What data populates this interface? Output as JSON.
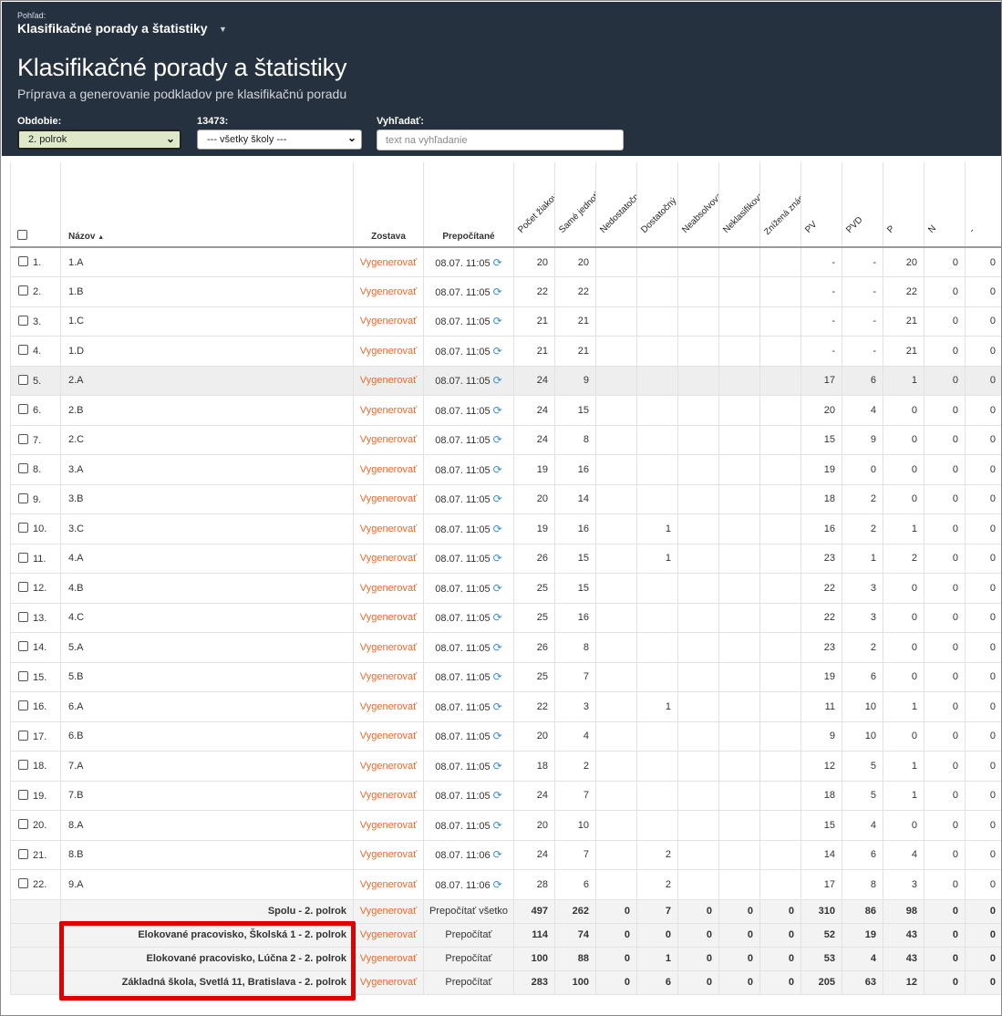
{
  "header": {
    "view_label": "Pohľad:",
    "view_title": "Klasifikačné porady a štatistiky",
    "title": "Klasifikačné porady a štatistiky",
    "subtitle": "Príprava a generovanie podkladov pre klasifikačnú poradu"
  },
  "filters": {
    "period_label": "Obdobie:",
    "period_value": "2. polrok",
    "school_label": "13473:",
    "school_value": "--- všetky školy ---",
    "search_label": "Vyhľadať:",
    "search_placeholder": "text na vyhľadanie"
  },
  "table": {
    "columns": {
      "name": "Názov",
      "sort_indicator": "▲",
      "report": "Zostava",
      "recalc": "Prepočítané",
      "stats": [
        "Počet žiakov",
        "Samé jednotky",
        "Nedostatočný",
        "Dostatočný",
        "Neabsolvoval(a)",
        "Neklasifikovaný(á)",
        "Znížená známka zo správania",
        "PV",
        "PVD",
        "P",
        "N",
        "-"
      ]
    },
    "generate_label": "Vygenerovať",
    "refresh_icon": "refresh-icon",
    "rows": [
      {
        "num": "1.",
        "name": "1.A",
        "date": "08.07. 11:05",
        "v": [
          "20",
          "20",
          "",
          "",
          "",
          "",
          "",
          "-",
          "-",
          "20",
          "0",
          "0"
        ]
      },
      {
        "num": "2.",
        "name": "1.B",
        "date": "08.07. 11:05",
        "v": [
          "22",
          "22",
          "",
          "",
          "",
          "",
          "",
          "-",
          "-",
          "22",
          "0",
          "0"
        ]
      },
      {
        "num": "3.",
        "name": "1.C",
        "date": "08.07. 11:05",
        "v": [
          "21",
          "21",
          "",
          "",
          "",
          "",
          "",
          "-",
          "-",
          "21",
          "0",
          "0"
        ]
      },
      {
        "num": "4.",
        "name": "1.D",
        "date": "08.07. 11:05",
        "v": [
          "21",
          "21",
          "",
          "",
          "",
          "",
          "",
          "-",
          "-",
          "21",
          "0",
          "0"
        ]
      },
      {
        "num": "5.",
        "name": "2.A",
        "date": "08.07. 11:05",
        "v": [
          "24",
          "9",
          "",
          "",
          "",
          "",
          "",
          "17",
          "6",
          "1",
          "0",
          "0"
        ],
        "highlight": true
      },
      {
        "num": "6.",
        "name": "2.B",
        "date": "08.07. 11:05",
        "v": [
          "24",
          "15",
          "",
          "",
          "",
          "",
          "",
          "20",
          "4",
          "0",
          "0",
          "0"
        ]
      },
      {
        "num": "7.",
        "name": "2.C",
        "date": "08.07. 11:05",
        "v": [
          "24",
          "8",
          "",
          "",
          "",
          "",
          "",
          "15",
          "9",
          "0",
          "0",
          "0"
        ]
      },
      {
        "num": "8.",
        "name": "3.A",
        "date": "08.07. 11:05",
        "v": [
          "19",
          "16",
          "",
          "",
          "",
          "",
          "",
          "19",
          "0",
          "0",
          "0",
          "0"
        ]
      },
      {
        "num": "9.",
        "name": "3.B",
        "date": "08.07. 11:05",
        "v": [
          "20",
          "14",
          "",
          "",
          "",
          "",
          "",
          "18",
          "2",
          "0",
          "0",
          "0"
        ]
      },
      {
        "num": "10.",
        "name": "3.C",
        "date": "08.07. 11:05",
        "v": [
          "19",
          "16",
          "",
          "1",
          "",
          "",
          "",
          "16",
          "2",
          "1",
          "0",
          "0"
        ]
      },
      {
        "num": "11.",
        "name": "4.A",
        "date": "08.07. 11:05",
        "v": [
          "26",
          "15",
          "",
          "1",
          "",
          "",
          "",
          "23",
          "1",
          "2",
          "0",
          "0"
        ]
      },
      {
        "num": "12.",
        "name": "4.B",
        "date": "08.07. 11:05",
        "v": [
          "25",
          "15",
          "",
          "",
          "",
          "",
          "",
          "22",
          "3",
          "0",
          "0",
          "0"
        ]
      },
      {
        "num": "13.",
        "name": "4.C",
        "date": "08.07. 11:05",
        "v": [
          "25",
          "16",
          "",
          "",
          "",
          "",
          "",
          "22",
          "3",
          "0",
          "0",
          "0"
        ]
      },
      {
        "num": "14.",
        "name": "5.A",
        "date": "08.07. 11:05",
        "v": [
          "26",
          "8",
          "",
          "",
          "",
          "",
          "",
          "23",
          "2",
          "0",
          "0",
          "0"
        ]
      },
      {
        "num": "15.",
        "name": "5.B",
        "date": "08.07. 11:05",
        "v": [
          "25",
          "7",
          "",
          "",
          "",
          "",
          "",
          "19",
          "6",
          "0",
          "0",
          "0"
        ]
      },
      {
        "num": "16.",
        "name": "6.A",
        "date": "08.07. 11:05",
        "v": [
          "22",
          "3",
          "",
          "1",
          "",
          "",
          "",
          "11",
          "10",
          "1",
          "0",
          "0"
        ]
      },
      {
        "num": "17.",
        "name": "6.B",
        "date": "08.07. 11:05",
        "v": [
          "20",
          "4",
          "",
          "",
          "",
          "",
          "",
          "9",
          "10",
          "0",
          "0",
          "0"
        ]
      },
      {
        "num": "18.",
        "name": "7.A",
        "date": "08.07. 11:05",
        "v": [
          "18",
          "2",
          "",
          "",
          "",
          "",
          "",
          "12",
          "5",
          "1",
          "0",
          "0"
        ]
      },
      {
        "num": "19.",
        "name": "7.B",
        "date": "08.07. 11:05",
        "v": [
          "24",
          "7",
          "",
          "",
          "",
          "",
          "",
          "18",
          "5",
          "1",
          "0",
          "0"
        ]
      },
      {
        "num": "20.",
        "name": "8.A",
        "date": "08.07. 11:05",
        "v": [
          "20",
          "10",
          "",
          "",
          "",
          "",
          "",
          "15",
          "4",
          "0",
          "0",
          "0"
        ]
      },
      {
        "num": "21.",
        "name": "8.B",
        "date": "08.07. 11:06",
        "v": [
          "24",
          "7",
          "",
          "2",
          "",
          "",
          "",
          "14",
          "6",
          "4",
          "0",
          "0"
        ]
      },
      {
        "num": "22.",
        "name": "9.A",
        "date": "08.07. 11:06",
        "v": [
          "28",
          "6",
          "",
          "2",
          "",
          "",
          "",
          "17",
          "8",
          "3",
          "0",
          "0"
        ]
      }
    ],
    "summaries": [
      {
        "name": "Spolu - 2. polrok",
        "recalc": "Prepočítať všetko",
        "v": [
          "497",
          "262",
          "0",
          "7",
          "0",
          "0",
          "0",
          "310",
          "86",
          "98",
          "0",
          "0"
        ]
      },
      {
        "name": "Elokované pracovisko, Školská 1  - 2. polrok",
        "recalc": "Prepočítať",
        "v": [
          "114",
          "74",
          "0",
          "0",
          "0",
          "0",
          "0",
          "52",
          "19",
          "43",
          "0",
          "0"
        ]
      },
      {
        "name": "Elokované pracovisko, Lúčna 2  - 2. polrok",
        "recalc": "Prepočítať",
        "v": [
          "100",
          "88",
          "0",
          "1",
          "0",
          "0",
          "0",
          "53",
          "4",
          "43",
          "0",
          "0"
        ]
      },
      {
        "name": "Základná škola, Svetlá 11, Bratislava  - 2. polrok",
        "recalc": "Prepočítať",
        "v": [
          "283",
          "100",
          "0",
          "6",
          "0",
          "0",
          "0",
          "205",
          "63",
          "12",
          "0",
          "0"
        ]
      }
    ]
  },
  "annotation": {
    "color": "#e00000"
  }
}
